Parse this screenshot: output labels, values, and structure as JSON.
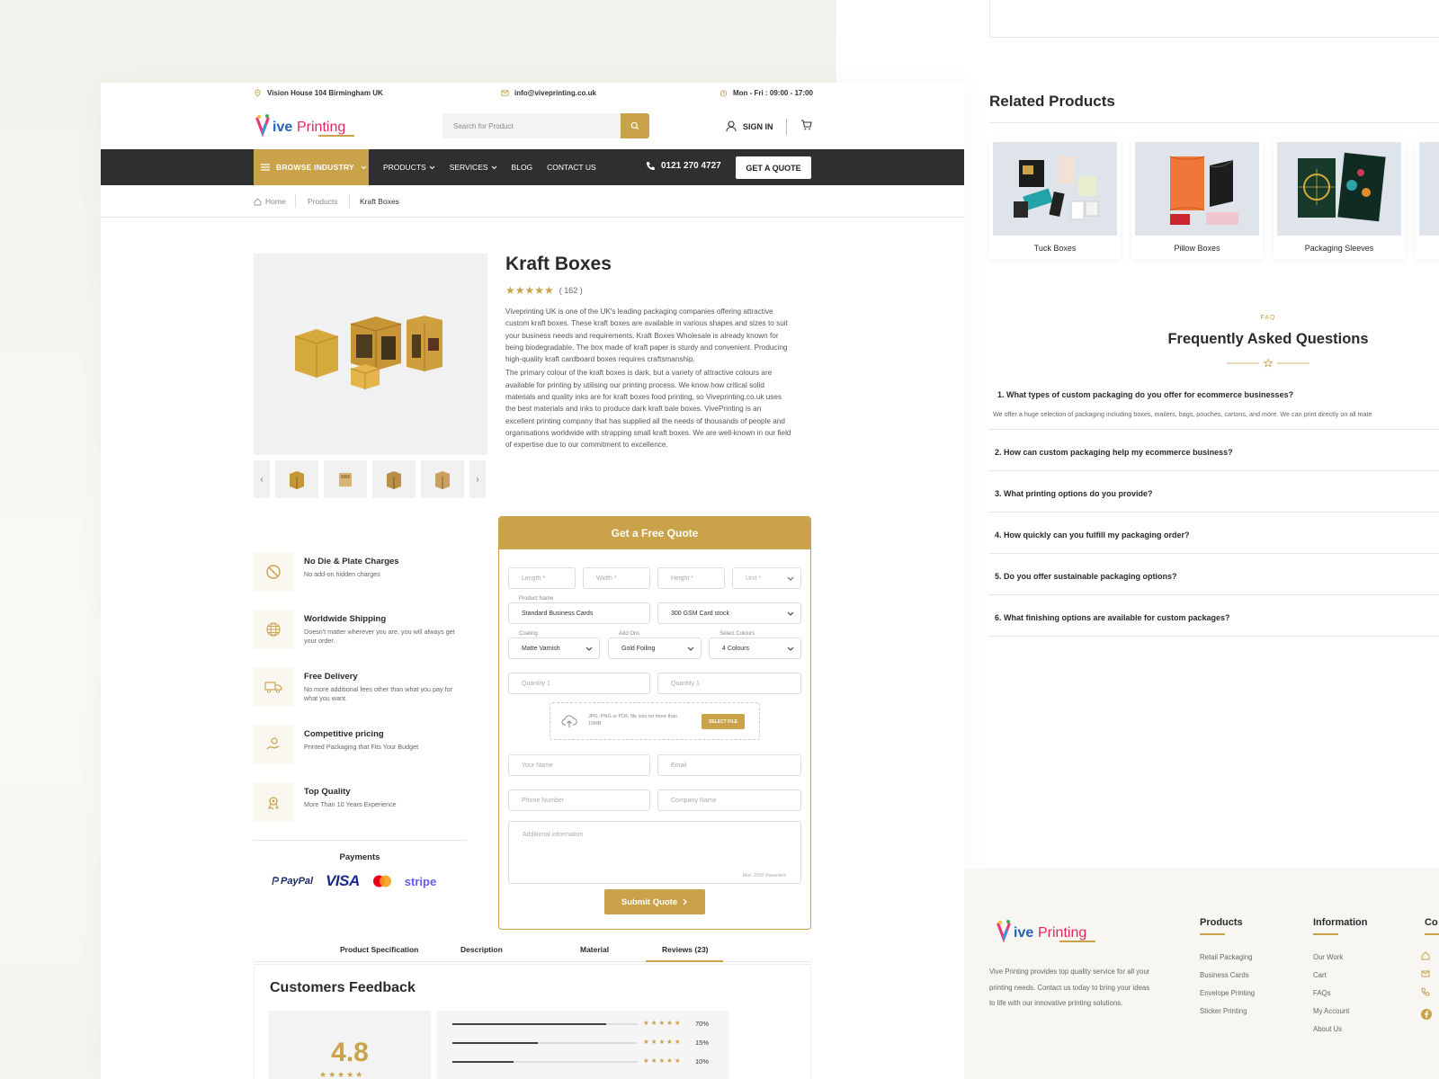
{
  "topbar": {
    "address": "Vision House 104  Birmingham UK",
    "email": "info@viveprinting.co.uk",
    "hours": "Mon - Fri : 09:00 - 17:00"
  },
  "header": {
    "logo_text": "VivePrinting",
    "search_placeholder": "Search for Product",
    "signin_label": "SIGN IN"
  },
  "nav": {
    "browse_label": "BROWSE INDUSTRY",
    "items": [
      "PRODUCTS",
      "SERVICES",
      "BLOG",
      "CONTACT US"
    ],
    "phone": "0121 270 4727",
    "quote_label": "GET A QUOTE"
  },
  "breadcrumb": [
    "Home",
    "Products",
    "Kraft Boxes"
  ],
  "product": {
    "title": "Kraft Boxes",
    "stars": "★★★★★",
    "review_count": "( 162 )",
    "desc_1": "Viveprinting UK is one of the UK's leading packaging companies offering attractive custom kraft boxes. These kraft boxes are available in various shapes and sizes to suit your business needs and requirements. Kraft Boxes Wholesale is already known for being biodegradable. The box made of kraft paper is sturdy and convenient. Producing high-quality kraft cardboard boxes requires craftsmanship.",
    "desc_2": "The primary colour of the kraft boxes is dark, but a variety of attractive colours are available for printing by utilising our printing process. We know how critical solid materials and quality inks are for kraft boxes food printing, so Viveprinting.co.uk uses the best materials and inks to produce dark kraft bale boxes. VivePrinting is an excellent printing company that has supplied all the needs of thousands of people and organisations worldwide with strapping small kraft boxes. We are well-known in our field of expertise due to our commitment to excellence."
  },
  "features": [
    {
      "title": "No Die &  Plate Charges",
      "text": "No add-on hidden charges",
      "icon": "no-sign-icon"
    },
    {
      "title": "Worldwide Shipping",
      "text": "Doesn't matter wherever you are, you will always get your order.",
      "icon": "globe-icon"
    },
    {
      "title": "Free Delivery",
      "text": "No more additional fees other than what you pay for what you want.",
      "icon": "truck-icon"
    },
    {
      "title": "Competitive  pricing",
      "text": "Printed Packaging that Fits Your Budget",
      "icon": "hand-coin-icon"
    },
    {
      "title": "Top Quality",
      "text": "More Than 10 Years Experience",
      "icon": "award-icon"
    }
  ],
  "payments": {
    "title": "Payments",
    "paypal": "PayPal",
    "visa": "VISA",
    "stripe": "stripe"
  },
  "quote_form": {
    "title": "Get a Free Quote",
    "length": "Length *",
    "width": "Width *",
    "height": "Height *",
    "unit": "Unit *",
    "product_name_label": "Product Name",
    "product_name": "Standard Business Cards",
    "stock": "300 GSM Card stock",
    "coating_label": "Coating",
    "coating": "Matte Varnish",
    "addons_label": "Add Ons",
    "addons": "Gold Foiling",
    "colours_label": "Select Colours",
    "colours": "4 Colours",
    "quantity_1": "Quantity 1",
    "quantity_2": "Quantity 1",
    "upload_text": "JPG, PNG or PDF, file size no more than 10MB",
    "upload_btn": "SELECT FILE",
    "your_name": "Your Name",
    "email": "Email",
    "phone": "Phone Number",
    "company": "Company Name",
    "additional": "Additional information",
    "max_chars": "Max. 2000 characters",
    "submit": "Submit Quote"
  },
  "tabs": [
    "Product Specification",
    "Description",
    "Material",
    "Reviews (23)"
  ],
  "feedback": {
    "title": "Customers Feedback",
    "rating": "4.8",
    "stars": "★★★★★",
    "bars": [
      {
        "stars": "★★★★★",
        "pct": "70%",
        "value": 0.83
      },
      {
        "stars": "★★★★★",
        "pct": "15%",
        "value": 0.46
      },
      {
        "stars": "★★★★★",
        "pct": "10%",
        "value": 0.33
      }
    ]
  },
  "related": {
    "title": "Related Products",
    "items": [
      "Tuck Boxes",
      "Pillow Boxes",
      "Packaging Sleeves"
    ]
  },
  "faq": {
    "tag": "FAQ",
    "title": "Frequently Asked Questions",
    "items": [
      {
        "q": "1. What types of custom packaging do you offer for ecommerce businesses?",
        "a": "We offer a huge selection of packaging including boxes, mailers, bags, pouches, cartons, and more. We can print directly on all mate"
      },
      {
        "q": "2. How can custom packaging help my ecommerce business?"
      },
      {
        "q": "3. What printing options do you provide?"
      },
      {
        "q": "4. How quickly can you fulfill my packaging order?"
      },
      {
        "q": "5. Do you offer sustainable packaging options?"
      },
      {
        "q": "6. What finishing options are available for custom packages?"
      }
    ]
  },
  "footer": {
    "about": "Vive Printing provides top quality service for all your printing needs. Contact us today to bring your ideas to life with our innovative printing solutions.",
    "products_title": "Products",
    "products": [
      "Retail Packaging",
      "Business Cards",
      "Envelope Printing",
      "Sticker Printing"
    ],
    "info_title": "Information",
    "info": [
      "Our Work",
      "Cart",
      "FAQs",
      "My Account",
      "About Us"
    ],
    "contact_title": "Co"
  },
  "colors": {
    "accent": "#c9a24a",
    "nav_bg": "#2e2f30"
  }
}
